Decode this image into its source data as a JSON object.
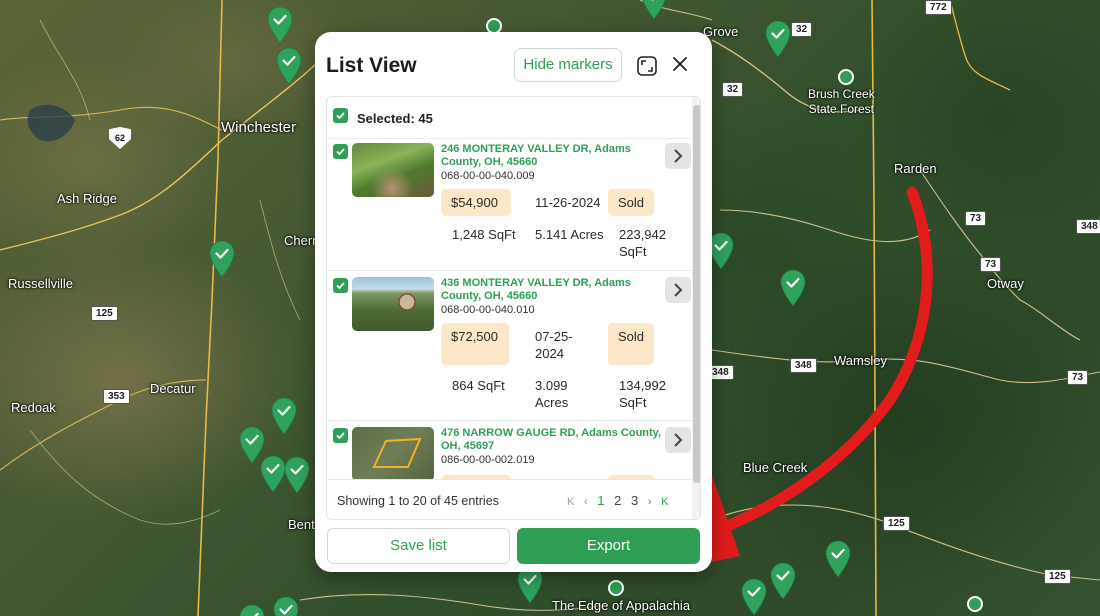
{
  "map": {
    "labels": {
      "winchester": "Winchester",
      "ash_ridge": "Ash Ridge",
      "russellville": "Russellville",
      "decatur": "Decatur",
      "redoak": "Redoak",
      "cherry": "Cherr",
      "bent": "Bent",
      "brush_creek": "Brush Creek\nState Forest",
      "rarden": "Rarden",
      "otway": "Otway",
      "wamsley": "Wamsley",
      "blue_creek": "Blue Creek",
      "grove": "Grove",
      "edge_of_appalachia": "The Edge of Appalachia"
    },
    "shields": {
      "r32a": "32",
      "r32b": "32",
      "r73a": "73",
      "r73b": "73",
      "r73c": "73",
      "r348a": "348",
      "r348b": "348",
      "r348c": "348",
      "r125a": "125",
      "r125b": "125",
      "r125c": "125",
      "r353": "353",
      "r772": "772",
      "us62": "62"
    }
  },
  "panel": {
    "title": "List View",
    "hide_markers_label": "Hide markers",
    "selected_label": "Selected: 45",
    "items": [
      {
        "address": "246 MONTERAY VALLEY DR, Adams County, OH, 45660",
        "parcel": "068-00-00-040.009",
        "price": "$54,900",
        "date": "11-26-2024",
        "status": "Sold",
        "sqft": "1,248 SqFt",
        "acres": "5.141 Acres",
        "lot_sqft": "223,942 SqFt"
      },
      {
        "address": "436 MONTERAY VALLEY DR, Adams County, OH, 45660",
        "parcel": "068-00-00-040.010",
        "price": "$72,500",
        "date": "07-25-2024",
        "status": "Sold",
        "sqft": "864 SqFt",
        "acres": "3.099 Acres",
        "lot_sqft": "134,992 SqFt"
      },
      {
        "address": "476 NARROW GAUGE RD, Adams County, OH, 45697",
        "parcel": "086-00-00-002.019"
      }
    ],
    "footer_text": "Showing 1 to 20 of 45 entries",
    "pager": {
      "first": "K",
      "prev": "‹",
      "pages": [
        "1",
        "2",
        "3"
      ],
      "next": "›",
      "last": "K"
    },
    "save_list_label": "Save list",
    "export_label": "Export"
  },
  "colors": {
    "accent_green": "#2f9e56",
    "tag_peach": "#fce8c8",
    "arrow_red": "#e21b1b",
    "pin_green": "#2fa35c"
  }
}
